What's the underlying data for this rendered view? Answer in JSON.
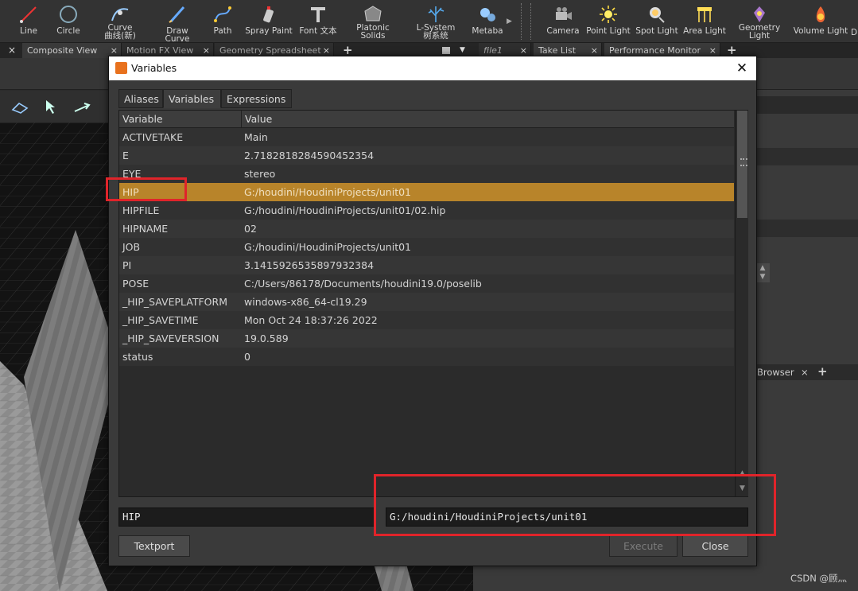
{
  "shelf": {
    "tools": [
      {
        "label": "Line",
        "icon": "line-icon"
      },
      {
        "label": "Circle",
        "icon": "circle-icon"
      },
      {
        "label": "Curve",
        "label2": "曲线(新)",
        "icon": "curve-icon"
      },
      {
        "label": "Draw Curve",
        "icon": "draw-curve-icon"
      },
      {
        "label": "Path",
        "icon": "path-icon"
      },
      {
        "label": "Spray Paint",
        "icon": "spray-paint-icon"
      },
      {
        "label": "Font 文本",
        "icon": "font-icon"
      },
      {
        "label": "Platonic",
        "label2": "Solids",
        "icon": "platonic-solids-icon"
      },
      {
        "label": "L-System",
        "label2": "树系统",
        "icon": "lsystem-icon"
      },
      {
        "label": "Metaba",
        "icon": "metaball-icon"
      },
      {
        "label": "Camera",
        "icon": "camera-icon"
      },
      {
        "label": "Point Light",
        "icon": "point-light-icon"
      },
      {
        "label": "Spot Light",
        "icon": "spot-light-icon"
      },
      {
        "label": "Area Light",
        "icon": "area-light-icon"
      },
      {
        "label": "Geometry",
        "label2": "Light",
        "icon": "geometry-light-icon"
      },
      {
        "label": "Volume Light",
        "icon": "volume-light-icon"
      },
      {
        "label": "D",
        "icon": "more-icon"
      }
    ]
  },
  "tabs_left": [
    "Composite View",
    "Motion FX View",
    "Geometry Spreadsheet"
  ],
  "tabs_right": [
    "file1",
    "Take List",
    "Performance Monitor"
  ],
  "lower_tab": "Browser",
  "dialog": {
    "title": "Variables",
    "tabs": [
      "Aliases",
      "Variables",
      "Expressions"
    ],
    "active_tab": "Variables",
    "columns": [
      "Variable",
      "Value"
    ],
    "rows": [
      {
        "name": "ACTIVETAKE",
        "value": "Main"
      },
      {
        "name": "E",
        "value": "2.7182818284590452354"
      },
      {
        "name": "EYE",
        "value": "stereo"
      },
      {
        "name": "HIP",
        "value": "G:/houdini/HoudiniProjects/unit01"
      },
      {
        "name": "HIPFILE",
        "value": "G:/houdini/HoudiniProjects/unit01/02.hip"
      },
      {
        "name": "HIPNAME",
        "value": "02"
      },
      {
        "name": "JOB",
        "value": "G:/houdini/HoudiniProjects/unit01"
      },
      {
        "name": "PI",
        "value": "3.1415926535897932384"
      },
      {
        "name": "POSE",
        "value": "C:/Users/86178/Documents/houdini19.0/poselib"
      },
      {
        "name": "_HIP_SAVEPLATFORM",
        "value": "windows-x86_64-cl19.29"
      },
      {
        "name": "_HIP_SAVETIME",
        "value": "Mon Oct 24 18:37:26 2022"
      },
      {
        "name": "_HIP_SAVEVERSION",
        "value": "19.0.589"
      },
      {
        "name": "status",
        "value": "0"
      }
    ],
    "selected_row": 3,
    "name_field": "HIP",
    "value_field": "G:/houdini/HoudiniProjects/unit01",
    "buttons": {
      "textport": "Textport",
      "execute": "Execute",
      "close": "Close"
    }
  },
  "watermark": "CSDN @顾灬",
  "colors": {
    "selection": "#b8842a",
    "highlight": "#e0242a",
    "accent": "#e8711d"
  }
}
